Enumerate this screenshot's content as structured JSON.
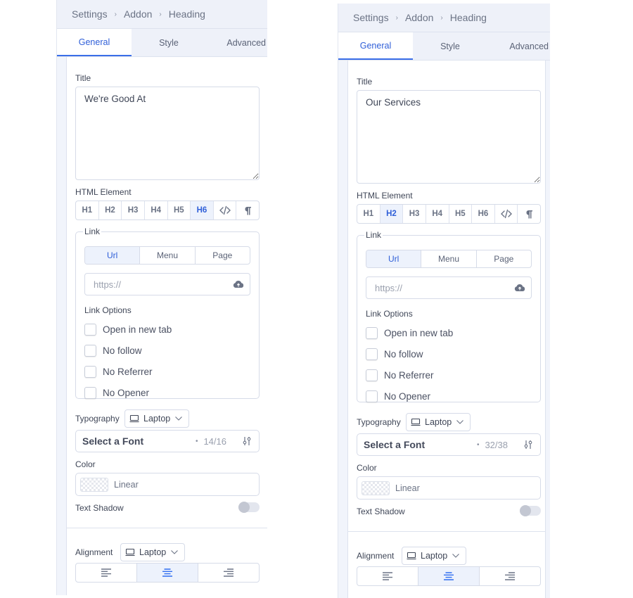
{
  "panels": [
    {
      "breadcrumb": [
        "Settings",
        "Addon",
        "Heading"
      ],
      "tabs": [
        "General",
        "Style",
        "Advanced"
      ],
      "active_tab": "General",
      "title_label": "Title",
      "title_value": "We're Good At",
      "html_element_label": "HTML Element",
      "html_elements": [
        "H1",
        "H2",
        "H3",
        "H4",
        "H5",
        "H6"
      ],
      "html_element_selected": "H6",
      "link": {
        "legend": "Link",
        "types": [
          "Url",
          "Menu",
          "Page"
        ],
        "selected_type": "Url",
        "url_placeholder": "https://",
        "url_value": "",
        "options_label": "Link Options",
        "options": [
          {
            "label": "Open in new tab",
            "checked": false
          },
          {
            "label": "No follow",
            "checked": false
          },
          {
            "label": "No Referrer",
            "checked": false
          },
          {
            "label": "No Opener",
            "checked": false
          }
        ]
      },
      "typography": {
        "label": "Typography",
        "device": "Laptop",
        "font": "Select a Font",
        "size": "14/16"
      },
      "color": {
        "label": "Color",
        "value": "Linear"
      },
      "text_shadow": {
        "label": "Text Shadow",
        "enabled": false
      },
      "alignment": {
        "label": "Alignment",
        "device": "Laptop",
        "options": [
          "left",
          "center",
          "right"
        ],
        "selected": "center"
      }
    },
    {
      "breadcrumb": [
        "Settings",
        "Addon",
        "Heading"
      ],
      "tabs": [
        "General",
        "Style",
        "Advanced"
      ],
      "active_tab": "General",
      "title_label": "Title",
      "title_value": "Our Services",
      "html_element_label": "HTML Element",
      "html_elements": [
        "H1",
        "H2",
        "H3",
        "H4",
        "H5",
        "H6"
      ],
      "html_element_selected": "H2",
      "link": {
        "legend": "Link",
        "types": [
          "Url",
          "Menu",
          "Page"
        ],
        "selected_type": "Url",
        "url_placeholder": "https://",
        "url_value": "",
        "options_label": "Link Options",
        "options": [
          {
            "label": "Open in new tab",
            "checked": false
          },
          {
            "label": "No follow",
            "checked": false
          },
          {
            "label": "No Referrer",
            "checked": false
          },
          {
            "label": "No Opener",
            "checked": false
          }
        ]
      },
      "typography": {
        "label": "Typography",
        "device": "Laptop",
        "font": "Select a Font",
        "size": "32/38"
      },
      "color": {
        "label": "Color",
        "value": "Linear"
      },
      "text_shadow": {
        "label": "Text Shadow",
        "enabled": false
      },
      "alignment": {
        "label": "Alignment",
        "device": "Laptop",
        "options": [
          "left",
          "center",
          "right"
        ],
        "selected": "center"
      }
    }
  ],
  "icons": {
    "breadcrumb_separator": "chevron-right-icon",
    "code": "code-icon",
    "paragraph": "paragraph-icon",
    "upload": "cloud-upload-icon",
    "device": "laptop-icon",
    "dropdown": "chevron-down-icon",
    "font_settings": "sliders-icon"
  },
  "colors": {
    "accent": "#2f5fd8",
    "active_bg": "#edf2fc",
    "border": "#d6dbe8",
    "panel_bg": "#eef1f9"
  }
}
